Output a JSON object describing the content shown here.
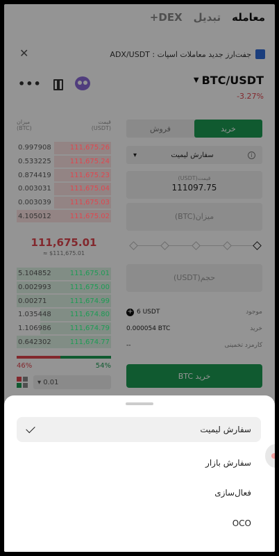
{
  "nav": {
    "tabs": [
      "معامله",
      "تبدیل",
      "DEX+"
    ]
  },
  "banner": {
    "text": "جفت‌ارز جدید معاملات اسپات : ADX/USDT"
  },
  "market": {
    "pair": "BTC/USDT",
    "change": "-3.27%"
  },
  "orderbook": {
    "price_header": "قیمت",
    "price_unit": "(USDT)",
    "amount_header": "میزان",
    "amount_unit": "(BTC)",
    "asks": [
      {
        "price": "111,675.26",
        "qty": "0.997908",
        "depth": 0.6
      },
      {
        "price": "111,675.24",
        "qty": "0.533225",
        "depth": 0.6
      },
      {
        "price": "111,675.23",
        "qty": "0.874419",
        "depth": 0.6
      },
      {
        "price": "111,675.04",
        "qty": "0.003031",
        "depth": 0.6
      },
      {
        "price": "111,675.03",
        "qty": "0.003039",
        "depth": 0.6
      },
      {
        "price": "111,675.02",
        "qty": "4.105012",
        "depth": 1.0
      }
    ],
    "mid_price": "111,675.01",
    "mid_fiat": "≈ $111,675.01",
    "bids": [
      {
        "price": "111,675.01",
        "qty": "5.104852",
        "depth": 1.0
      },
      {
        "price": "111,675.00",
        "qty": "0.002993",
        "depth": 1.0
      },
      {
        "price": "111,674.99",
        "qty": "0.00271",
        "depth": 1.0
      },
      {
        "price": "111,674.80",
        "qty": "1.035448",
        "depth": 0.75
      },
      {
        "price": "111,674.79",
        "qty": "1.106986",
        "depth": 0.75
      },
      {
        "price": "111,674.77",
        "qty": "0.642302",
        "depth": 1.0
      }
    ],
    "sell_ratio": "46%",
    "buy_ratio": "54%",
    "sell_fraction": 0.46,
    "step": "0.01"
  },
  "form": {
    "buy_label": "خرید",
    "sell_label": "فروش",
    "order_type": "سفارش لیمیت",
    "price_label": "قیمت",
    "price_unit": "(USDT)",
    "price_value": "111097.75",
    "amount_placeholder": "میزان(BTC)",
    "volume_placeholder": "حجم(USDT)",
    "balance_label": "موجود",
    "balance_value": "6 USDT",
    "buy_est_label": "خرید",
    "buy_est_value": "0.000054 BTC",
    "fee_label": "کارمزد تخمینی",
    "fee_value": "--",
    "submit_label": "خرید BTC"
  },
  "sheet": {
    "options": [
      "سفارش لیمیت",
      "سفارش بازار",
      "فعال‌سازی",
      "OCO"
    ]
  },
  "colors": {
    "buy": "#1c9c54",
    "sell": "#e0464f"
  }
}
